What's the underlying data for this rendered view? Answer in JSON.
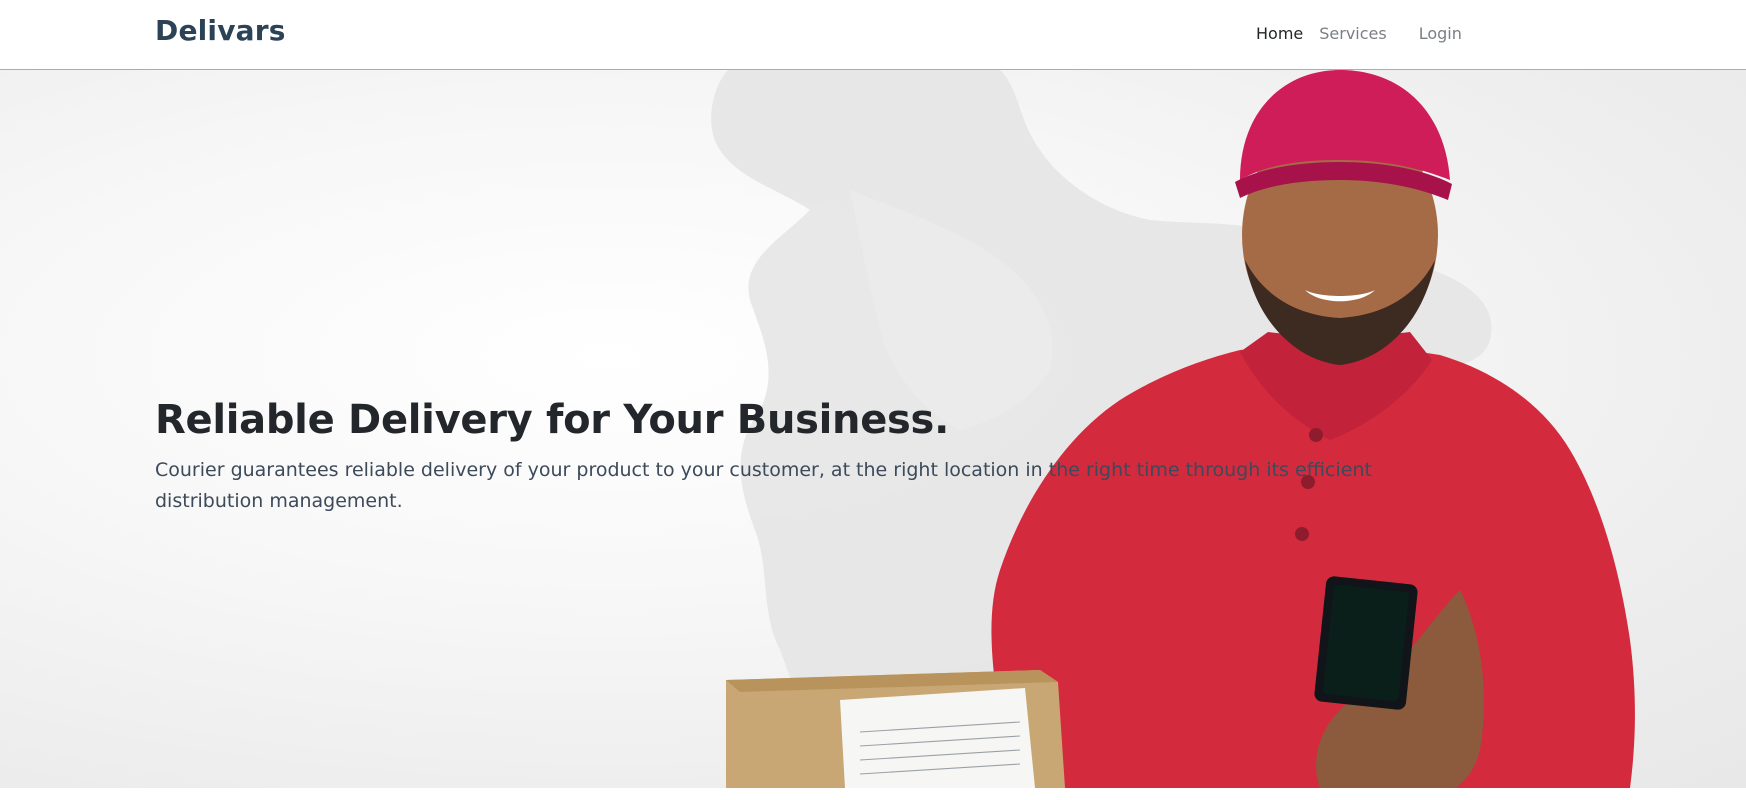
{
  "navbar": {
    "brand": "Delivars",
    "links": [
      {
        "label": "Home",
        "active": true
      },
      {
        "label": "Services",
        "active": false
      },
      {
        "label": "Login",
        "active": false
      }
    ]
  },
  "hero": {
    "title": "Reliable Delivery for Your Business.",
    "description": "Courier guarantees reliable delivery of your product to your customer, at the right location in the right time through its efficient distribution management.",
    "image": "courier-with-phone-and-package"
  },
  "colors": {
    "brand_text": "#2c4256",
    "nav_active": "#222629",
    "nav_inactive": "#7b7f84",
    "navbar_border": "#d99a93",
    "shirt_red": "#d42a3e",
    "cap_magenta": "#cf1d5a",
    "box_cardboard": "#c9a774"
  }
}
